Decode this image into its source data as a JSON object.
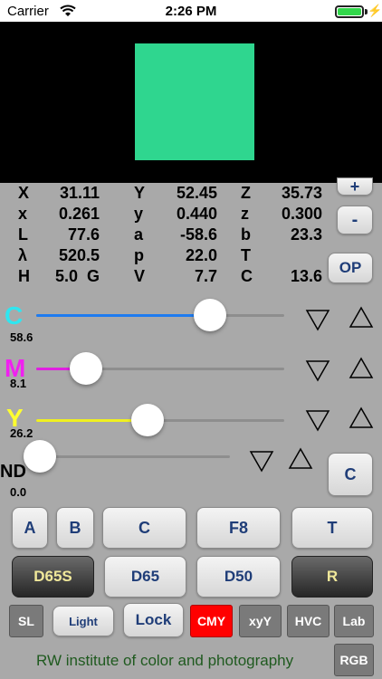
{
  "status_bar": {
    "carrier": "Carrier",
    "time": "2:26 PM"
  },
  "swatch_color": "#2fd68f",
  "readouts": {
    "rows": [
      [
        {
          "label": "X",
          "value": "31.11"
        },
        {
          "label": "Y",
          "value": "52.45"
        },
        {
          "label": "Z",
          "value": "35.73"
        }
      ],
      [
        {
          "label": "x",
          "value": "0.261"
        },
        {
          "label": "y",
          "value": "0.440"
        },
        {
          "label": "z",
          "value": "0.300"
        }
      ],
      [
        {
          "label": "L",
          "value": "77.6"
        },
        {
          "label": "a",
          "value": "-58.6"
        },
        {
          "label": "b",
          "value": "23.3"
        }
      ],
      [
        {
          "label": "λ",
          "value": "520.5"
        },
        {
          "label": "p",
          "value": "22.0"
        },
        {
          "label": "T",
          "value": ""
        }
      ],
      [
        {
          "label": "H",
          "value": "5.0  G"
        },
        {
          "label": "V",
          "value": "7.7"
        },
        {
          "label": "C",
          "value": "13.6"
        }
      ]
    ]
  },
  "side_buttons": {
    "plus": "+",
    "minus": "-",
    "op": "OP",
    "c": "C"
  },
  "sliders": [
    {
      "letter": "C",
      "value": "58.6",
      "fraction": 0.7,
      "color": "#1e7bf0",
      "letter_color": "#2fe6f0"
    },
    {
      "letter": "M",
      "value": "8.1",
      "fraction": 0.2,
      "color": "#e020e0",
      "letter_color": "#f020f0"
    },
    {
      "letter": "Y",
      "value": "26.2",
      "fraction": 0.45,
      "color": "#f0f020",
      "letter_color": "#ffff30"
    },
    {
      "letter": "ND",
      "value": "0.0",
      "fraction": 0.02,
      "color": "#8e8e8e",
      "letter_color": "#000000"
    }
  ],
  "row1_buttons": [
    "A",
    "B",
    "C",
    "F8",
    "T"
  ],
  "row2_buttons": [
    "D65S",
    "D65",
    "D50",
    "R"
  ],
  "row3_buttons": {
    "sl": "SL",
    "light": "Light",
    "lock": "Lock",
    "cmy": "CMY",
    "xyy": "xyY",
    "hvc": "HVC",
    "lab": "Lab"
  },
  "footer": {
    "text": "RW institute of color and photography",
    "rgb": "RGB"
  }
}
